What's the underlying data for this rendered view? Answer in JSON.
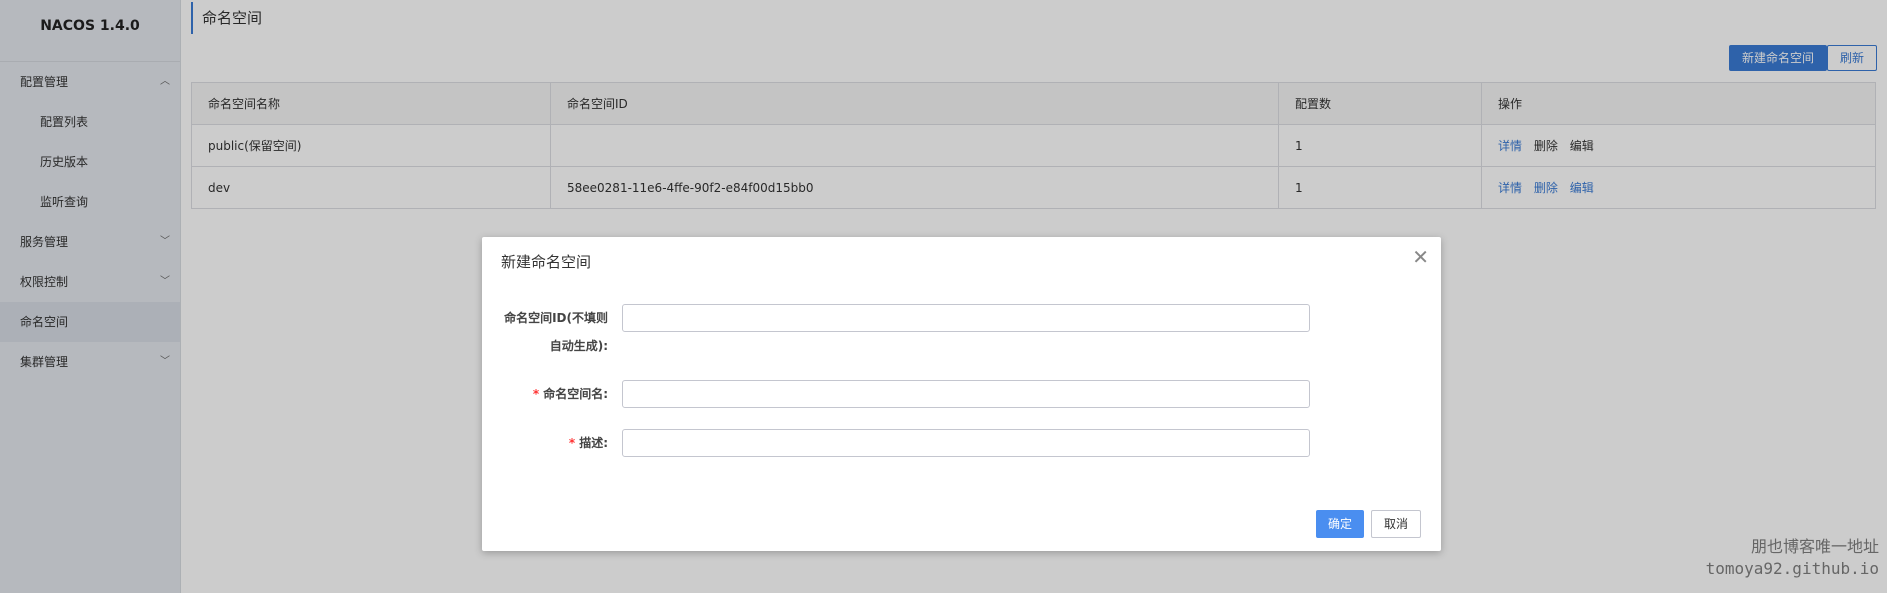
{
  "app": {
    "logo": "NACOS 1.4.0"
  },
  "sidebar": {
    "items": [
      {
        "label": "配置管理",
        "chevron": "chevron-up-icon"
      },
      {
        "label": "配置列表"
      },
      {
        "label": "历史版本"
      },
      {
        "label": "监听查询"
      },
      {
        "label": "服务管理",
        "chevron": "chevron-down-icon"
      },
      {
        "label": "权限控制",
        "chevron": "chevron-down-icon"
      },
      {
        "label": "命名空间",
        "active": true
      },
      {
        "label": "集群管理",
        "chevron": "chevron-down-icon"
      }
    ]
  },
  "page": {
    "title": "命名空间",
    "new_button": "新建命名空间",
    "refresh_button": "刷新"
  },
  "table": {
    "headers": [
      "命名空间名称",
      "命名空间ID",
      "配置数",
      "操作"
    ],
    "rows": [
      {
        "name": "public(保留空间)",
        "id": "",
        "count": "1",
        "actions": [
          "详情",
          "删除",
          "编辑"
        ]
      },
      {
        "name": "dev",
        "id": "58ee0281-11e6-4ffe-90f2-e84f00d15bb0",
        "count": "1",
        "actions": [
          "详情",
          "删除",
          "编辑"
        ]
      }
    ]
  },
  "dialog": {
    "title": "新建命名空间",
    "id_label_line1": "命名空间ID(不填则",
    "id_label_line2": "自动生成):",
    "name_label": "命名空间名:",
    "desc_label": "描述:",
    "required_mark": "*",
    "confirm_button": "确定",
    "cancel_button": "取消"
  },
  "watermark": {
    "line1": "朋也博客唯一地址",
    "line2": "tomoya92.github.io"
  },
  "colors": {
    "accent": "#3a7bd5",
    "required": "#ff3333"
  }
}
